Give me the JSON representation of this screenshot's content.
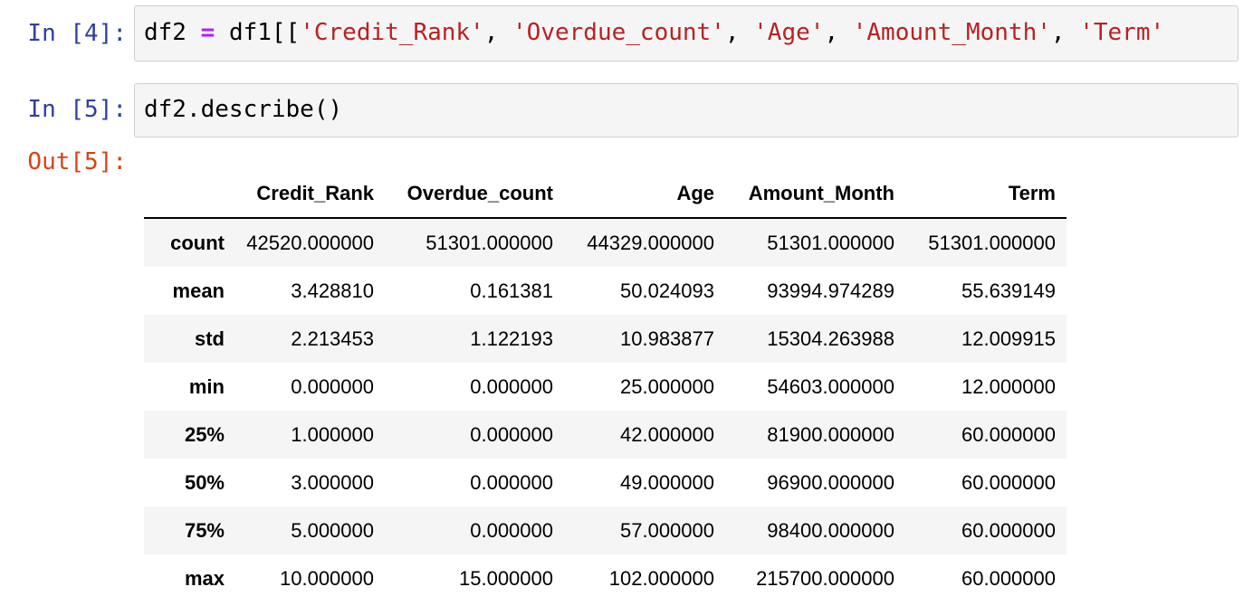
{
  "cells": [
    {
      "prompt": "In [4]:",
      "code": {
        "var": "df2",
        "op": "=",
        "obj": "df1[[",
        "columns": [
          "'Credit_Rank'",
          "'Overdue_count'",
          "'Age'",
          "'Amount_Month'",
          "'Term'"
        ],
        "sep": ","
      }
    },
    {
      "prompt": "In [5]:",
      "code_text": "df2.describe()"
    }
  ],
  "output": {
    "prompt": "Out[5]:",
    "table": {
      "index_header": "",
      "columns": [
        "Credit_Rank",
        "Overdue_count",
        "Age",
        "Amount_Month",
        "Term"
      ],
      "rows": [
        {
          "label": "count",
          "values": [
            "42520.000000",
            "51301.000000",
            "44329.000000",
            "51301.000000",
            "51301.000000"
          ]
        },
        {
          "label": "mean",
          "values": [
            "3.428810",
            "0.161381",
            "50.024093",
            "93994.974289",
            "55.639149"
          ]
        },
        {
          "label": "std",
          "values": [
            "2.213453",
            "1.122193",
            "10.983877",
            "15304.263988",
            "12.009915"
          ]
        },
        {
          "label": "min",
          "values": [
            "0.000000",
            "0.000000",
            "25.000000",
            "54603.000000",
            "12.000000"
          ]
        },
        {
          "label": "25%",
          "values": [
            "1.000000",
            "0.000000",
            "42.000000",
            "81900.000000",
            "60.000000"
          ]
        },
        {
          "label": "50%",
          "values": [
            "3.000000",
            "0.000000",
            "49.000000",
            "96900.000000",
            "60.000000"
          ]
        },
        {
          "label": "75%",
          "values": [
            "5.000000",
            "0.000000",
            "57.000000",
            "98400.000000",
            "60.000000"
          ]
        },
        {
          "label": "max",
          "values": [
            "10.000000",
            "15.000000",
            "102.000000",
            "215700.000000",
            "60.000000"
          ]
        }
      ]
    }
  },
  "colors": {
    "in_prompt": "#303f9f",
    "out_prompt": "#d84315",
    "string": "#ba2121",
    "operator": "#aa22ff",
    "input_bg": "#f5f5f5"
  }
}
